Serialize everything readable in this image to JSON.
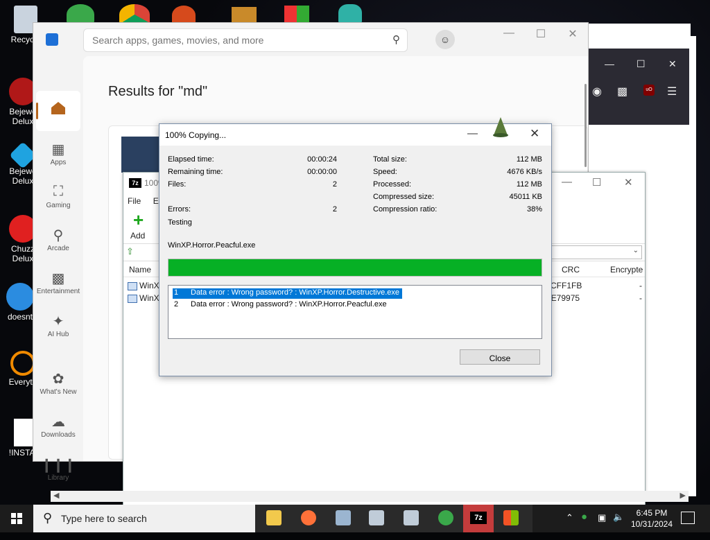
{
  "desktop": {
    "icons": [
      {
        "label": "Recycle"
      },
      {
        "label": "Bejewe\nDelux"
      },
      {
        "label": "Bejewe\nDelux"
      },
      {
        "label": "Chuzz\nDelux"
      },
      {
        "label": "doesnt"
      },
      {
        "label": "Everyth"
      },
      {
        "label": "!INSTAL"
      }
    ]
  },
  "store": {
    "search_placeholder": "Search apps, games, movies, and more",
    "results_title": "Results for \"md\"",
    "nav": [
      {
        "label": "Apps",
        "icon": "apps-icon"
      },
      {
        "label": "Gaming",
        "icon": "gamepad-icon"
      },
      {
        "label": "Arcade",
        "icon": "joystick-icon"
      },
      {
        "label": "Entertainment",
        "icon": "clapper-icon"
      },
      {
        "label": "AI Hub",
        "icon": "sparkle-icon"
      },
      {
        "label": "What's New",
        "icon": "megaphone-icon"
      },
      {
        "label": "Downloads",
        "icon": "download-icon"
      },
      {
        "label": "Library",
        "icon": "library-icon"
      }
    ]
  },
  "sevenzip": {
    "title": "100%",
    "menu": [
      "File",
      "Ed"
    ],
    "toolbar": {
      "add": "Add",
      "extract": "E"
    },
    "columns": {
      "name": "Name",
      "crc": "CRC",
      "encrypted": "Encrypte"
    },
    "rows": [
      {
        "name": "WinX",
        "crc": "CFF1FB",
        "enc": "-"
      },
      {
        "name": "WinX",
        "crc": "2E79975",
        "enc": "-"
      }
    ]
  },
  "dialog": {
    "title": "100% Copying...",
    "left": [
      {
        "label": "Elapsed time:",
        "value": "00:00:24"
      },
      {
        "label": "Remaining time:",
        "value": "00:00:00"
      },
      {
        "label": "Files:",
        "value": "2"
      },
      {
        "label": "Errors:",
        "value": "2"
      }
    ],
    "right": [
      {
        "label": "Total size:",
        "value": "112 MB"
      },
      {
        "label": "Speed:",
        "value": "4676 KB/s"
      },
      {
        "label": "Processed:",
        "value": "112 MB"
      },
      {
        "label": "Compressed size:",
        "value": "45011 KB"
      },
      {
        "label": "Compression ratio:",
        "value": "38%"
      }
    ],
    "status": "Testing",
    "current_file": "WinXP.Horror.Peacful.exe",
    "progress": 1.0,
    "progress_color": "#06b025",
    "errors": [
      {
        "n": "1",
        "text": "Data error : Wrong password? : WinXP.Horror.Destructive.exe"
      },
      {
        "n": "2",
        "text": "Data error : Wrong password? : WinXP.Horror.Peacful.exe"
      }
    ],
    "close_label": "Close"
  },
  "taskbar": {
    "search_placeholder": "Type here to search",
    "time": "6:45 PM",
    "date": "10/31/2024"
  }
}
